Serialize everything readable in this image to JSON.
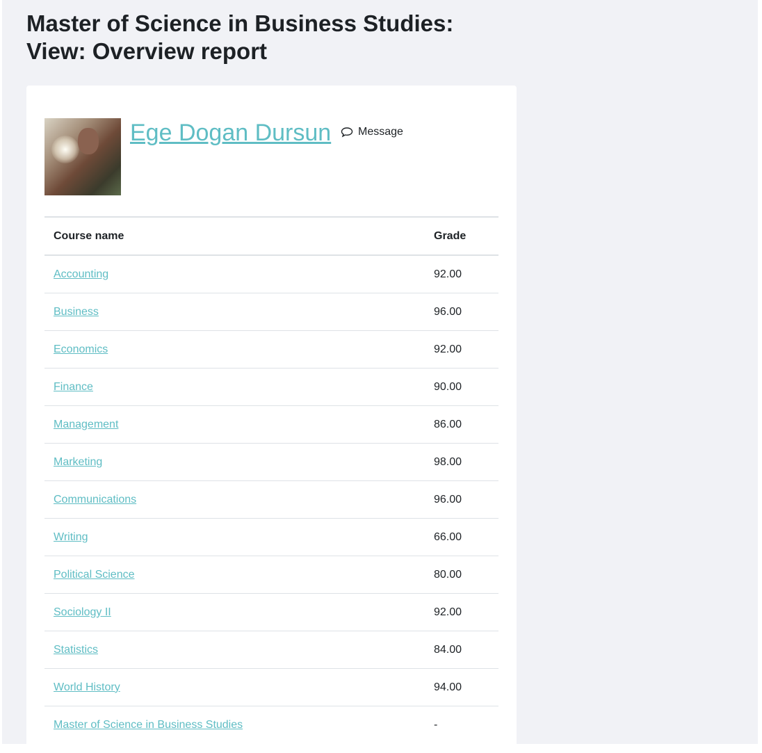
{
  "page_title_line1": "Master of Science in Business Studies:",
  "page_title_line2": "View: Overview report",
  "user": {
    "name": "Ege Dogan Dursun",
    "message_label": "Message"
  },
  "table": {
    "headers": {
      "course": "Course name",
      "grade": "Grade"
    },
    "rows": [
      {
        "course": "Accounting",
        "grade": "92.00"
      },
      {
        "course": "Business",
        "grade": "96.00"
      },
      {
        "course": "Economics",
        "grade": "92.00"
      },
      {
        "course": "Finance",
        "grade": "90.00"
      },
      {
        "course": "Management",
        "grade": "86.00"
      },
      {
        "course": "Marketing",
        "grade": "98.00"
      },
      {
        "course": "Communications",
        "grade": "96.00"
      },
      {
        "course": "Writing",
        "grade": "66.00"
      },
      {
        "course": "Political Science",
        "grade": "80.00"
      },
      {
        "course": "Sociology II",
        "grade": "92.00"
      },
      {
        "course": "Statistics",
        "grade": "84.00"
      },
      {
        "course": "World History",
        "grade": "94.00"
      },
      {
        "course": "Master of Science in Business Studies",
        "grade": "-"
      }
    ]
  },
  "colors": {
    "link": "#5fbdc4",
    "background": "#f1f2f6"
  }
}
